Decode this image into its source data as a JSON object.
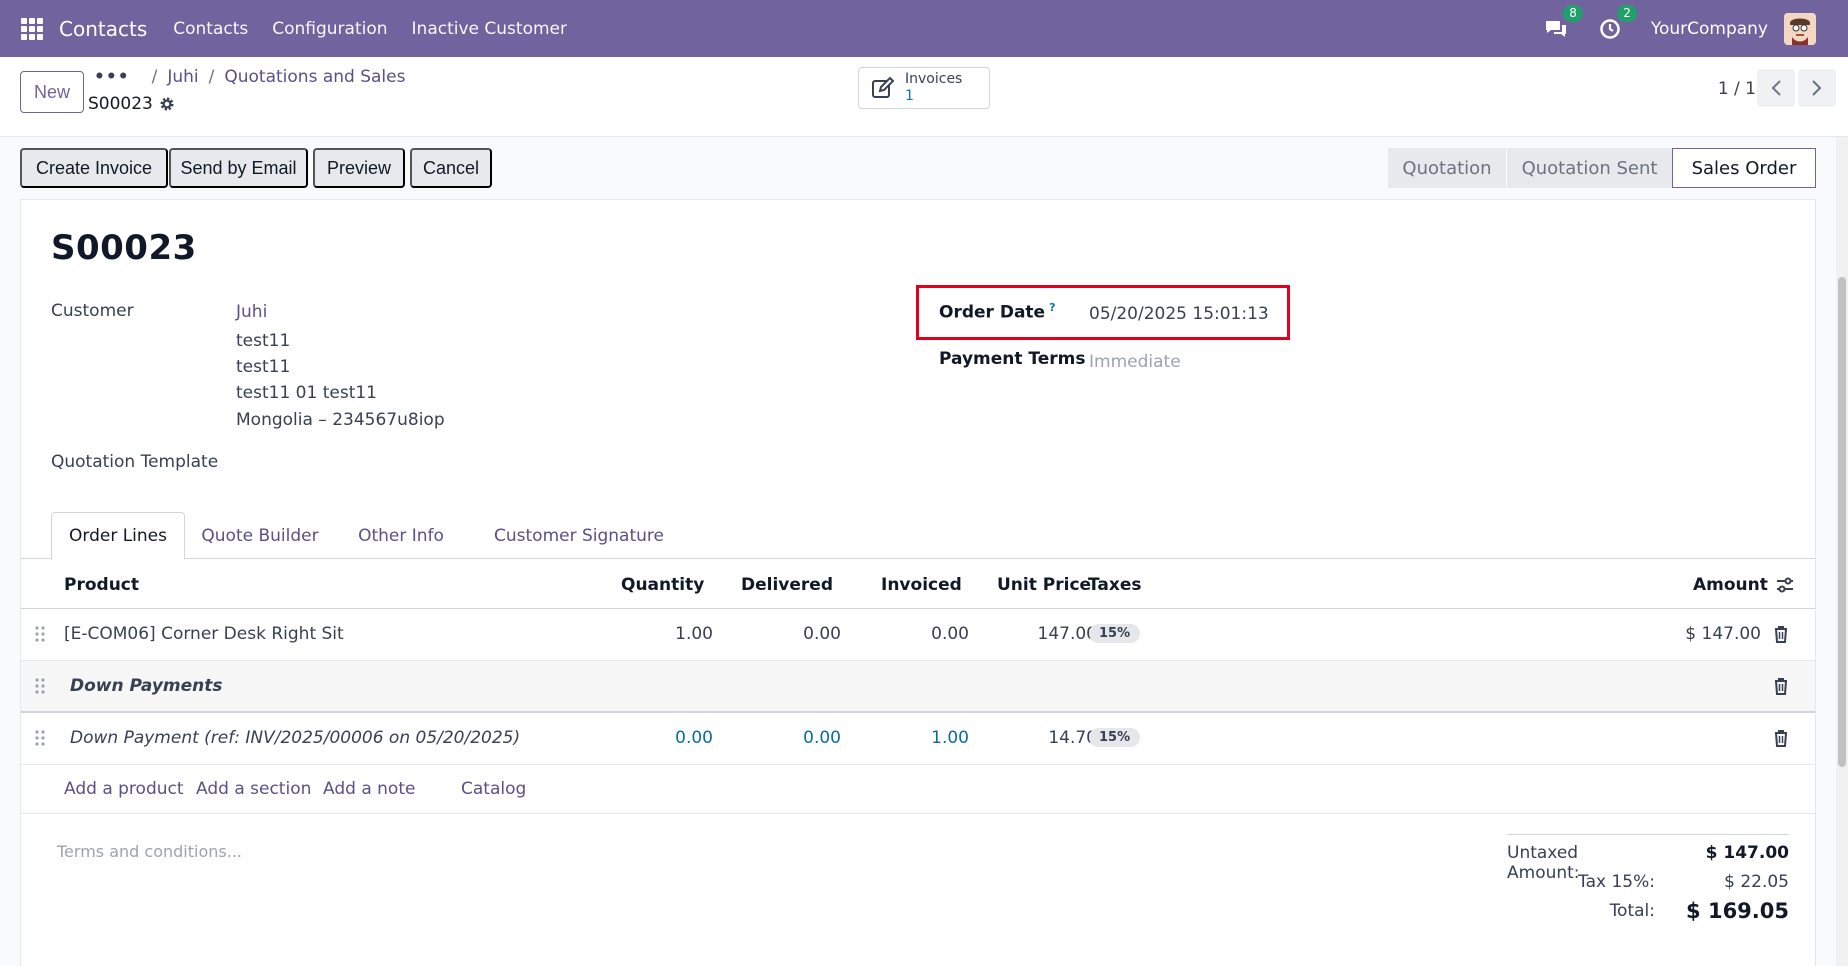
{
  "navbar": {
    "app_name": "Contacts",
    "menu": [
      "Contacts",
      "Configuration",
      "Inactive Customer"
    ],
    "messages_count": "8",
    "activities_count": "2",
    "company": "YourCompany"
  },
  "control_panel": {
    "new_label": "New",
    "breadcrumb": [
      "Juhi",
      "Quotations and Sales"
    ],
    "record_name": "S00023",
    "smart_button": {
      "label": "Invoices",
      "count": "1"
    },
    "pager": "1 / 1"
  },
  "actions": [
    "Create Invoice",
    "Send by Email",
    "Preview",
    "Cancel"
  ],
  "status_stages": [
    {
      "label": "Quotation",
      "active": false
    },
    {
      "label": "Quotation Sent",
      "active": false
    },
    {
      "label": "Sales Order",
      "active": true
    }
  ],
  "form": {
    "title": "S00023",
    "customer_label": "Customer",
    "customer_name": "Juhi",
    "customer_address": [
      "test11",
      "test11",
      "test11 01 test11",
      "Mongolia – 234567u8iop"
    ],
    "quotation_template_label": "Quotation Template",
    "order_date_label": "Order Date",
    "order_date_help": "?",
    "order_date_value": "05/20/2025 15:01:13",
    "payment_terms_label": "Payment Terms",
    "payment_terms_placeholder": "Immediate"
  },
  "tabs": [
    "Order Lines",
    "Quote Builder",
    "Other Info",
    "Customer Signature"
  ],
  "table": {
    "headers": {
      "product": "Product",
      "quantity": "Quantity",
      "delivered": "Delivered",
      "invoiced": "Invoiced",
      "unit_price": "Unit Price",
      "taxes": "Taxes",
      "amount": "Amount"
    },
    "line1": {
      "product": "[E-COM06] Corner Desk Right Sit",
      "quantity": "1.00",
      "delivered": "0.00",
      "invoiced": "0.00",
      "unit_price": "147.00",
      "tax": "15%",
      "amount": "$ 147.00"
    },
    "section": "Down Payments",
    "line2": {
      "product": "Down Payment (ref: INV/2025/00006 on 05/20/2025)",
      "quantity": "0.00",
      "delivered": "0.00",
      "invoiced": "1.00",
      "unit_price": "14.70",
      "tax": "15%"
    },
    "add_links": [
      "Add a product",
      "Add a section",
      "Add a note",
      "Catalog"
    ]
  },
  "terms_placeholder": "Terms and conditions...",
  "totals": {
    "untaxed_label": "Untaxed Amount:",
    "untaxed_value": "$ 147.00",
    "tax_label": "Tax 15%:",
    "tax_value": "$ 22.05",
    "total_label": "Total:",
    "total_value": "$ 169.05"
  },
  "colors": {
    "brand": "#71639e",
    "link": "#5c4f88",
    "highlight_border": "#e3001b",
    "badge": "#21a06a"
  }
}
